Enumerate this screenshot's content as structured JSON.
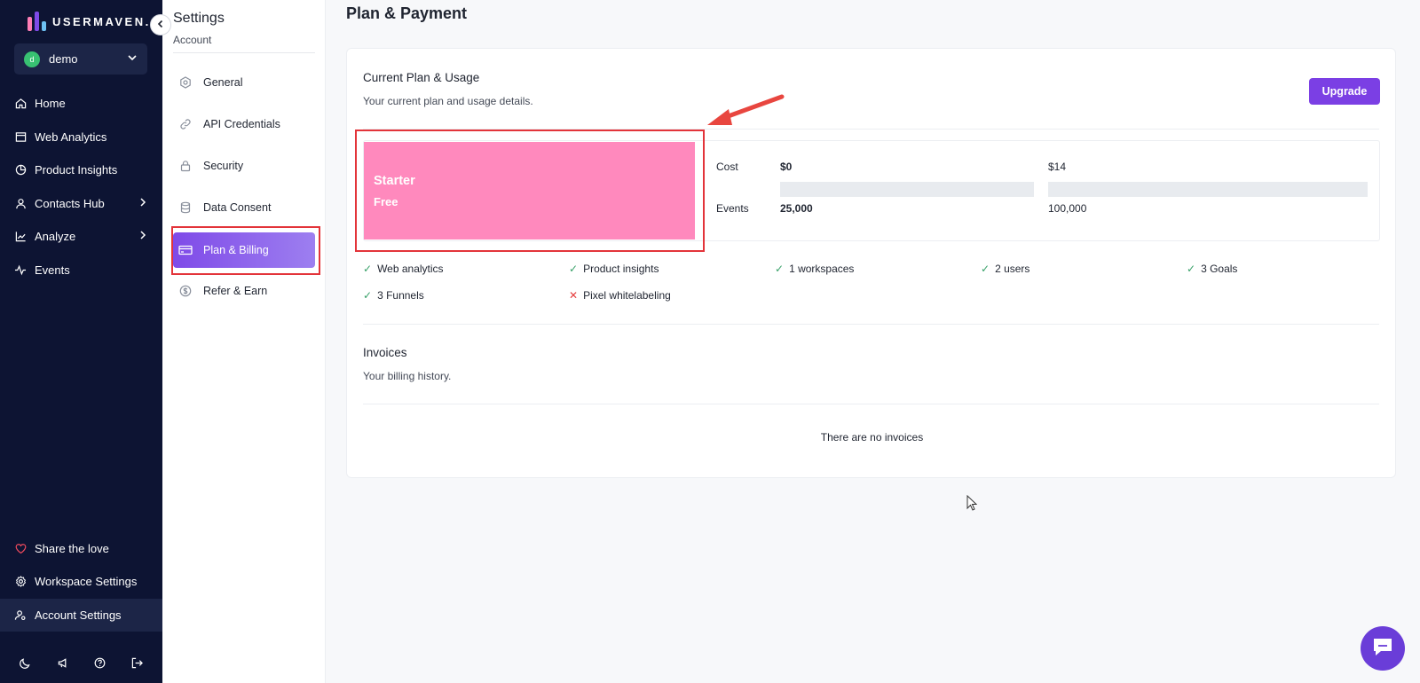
{
  "app": {
    "brand": "USERMAVEN.",
    "brand_colors": [
      "#ff7eb6",
      "#7f4ae8",
      "#6ec1f3"
    ]
  },
  "workspace": {
    "avatar": "d",
    "name": "demo"
  },
  "sidebar": {
    "items": [
      {
        "label": "Home",
        "icon": "home-icon"
      },
      {
        "label": "Web Analytics",
        "icon": "window-icon"
      },
      {
        "label": "Product Insights",
        "icon": "pie-chart-icon"
      },
      {
        "label": "Contacts Hub",
        "icon": "user-icon"
      },
      {
        "label": "Analyze",
        "icon": "line-chart-icon"
      },
      {
        "label": "Events",
        "icon": "pulse-icon"
      }
    ],
    "bottom_items": [
      {
        "label": "Share the love",
        "icon": "heart-icon"
      },
      {
        "label": "Workspace Settings",
        "icon": "gear-icon"
      },
      {
        "label": "Account Settings",
        "icon": "user-cog-icon"
      }
    ],
    "footer_icons": [
      "moon-icon",
      "megaphone-icon",
      "help-icon",
      "logout-icon"
    ]
  },
  "settings": {
    "title": "Settings",
    "subtitle": "Account",
    "items": [
      {
        "label": "General",
        "icon": "gear-icon"
      },
      {
        "label": "API Credentials",
        "icon": "link-icon"
      },
      {
        "label": "Security",
        "icon": "lock-icon"
      },
      {
        "label": "Data Consent",
        "icon": "database-icon"
      },
      {
        "label": "Plan & Billing",
        "icon": "credit-card-icon"
      },
      {
        "label": "Refer & Earn",
        "icon": "dollar-icon"
      }
    ]
  },
  "main": {
    "title": "Plan & Payment",
    "current_plan": {
      "title": "Current Plan & Usage",
      "subtitle": "Your current plan and usage details.",
      "upgrade_label": "Upgrade",
      "plan_name": "Starter",
      "plan_price": "Free",
      "plan_color": "#ff89bd",
      "usage": {
        "cost_label": "Cost",
        "events_label": "Events",
        "current_cost": "$0",
        "next_cost": "$14",
        "current_events": "25,000",
        "next_events": "100,000"
      }
    },
    "features": [
      {
        "label": "Web analytics",
        "included": true
      },
      {
        "label": "Product insights",
        "included": true
      },
      {
        "label": "1 workspaces",
        "included": true
      },
      {
        "label": "2 users",
        "included": true
      },
      {
        "label": "3 Goals",
        "included": true
      },
      {
        "label": "3 Funnels",
        "included": true
      },
      {
        "label": "Pixel whitelabeling",
        "included": false
      }
    ],
    "invoices": {
      "title": "Invoices",
      "subtitle": "Your billing history.",
      "empty": "There are no invoices"
    }
  },
  "colors": {
    "accent": "#7b3fe4",
    "highlight": "#e3343a",
    "check": "#38a169",
    "cross": "#e53e3e"
  }
}
